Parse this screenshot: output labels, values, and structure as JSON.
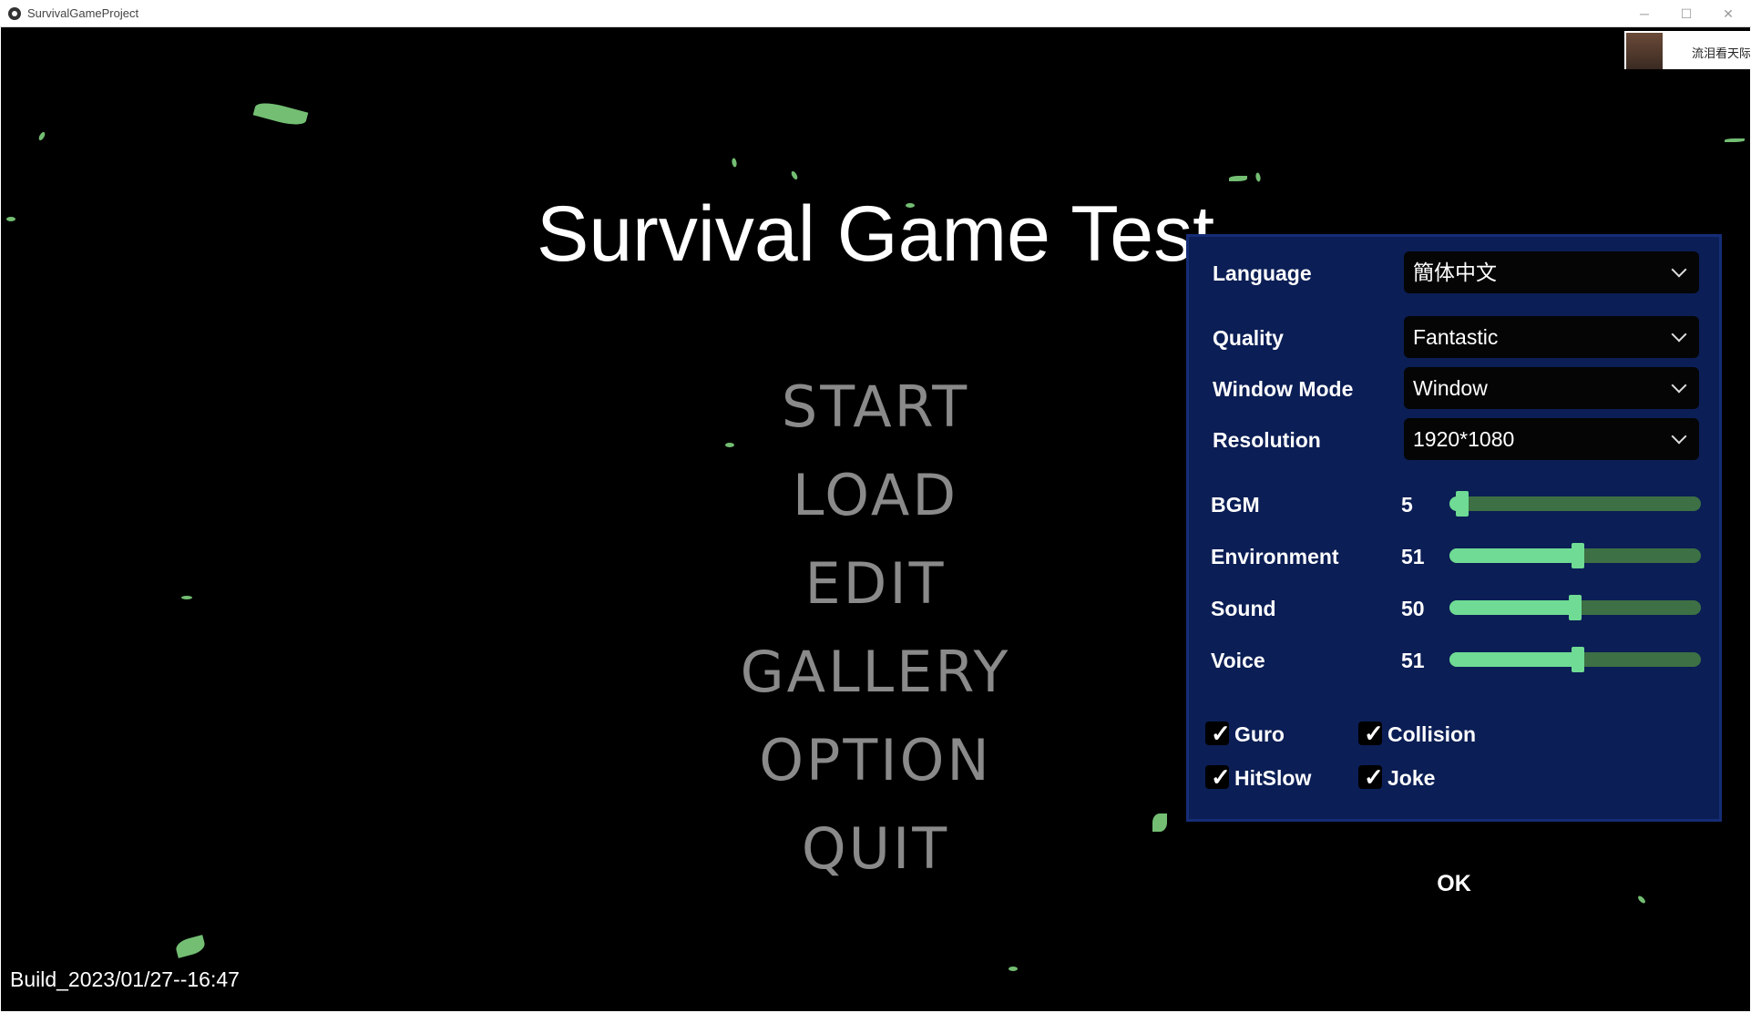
{
  "window": {
    "title": "SurvivalGameProject",
    "minimize_icon": "minimize-icon",
    "maximize_icon": "maximize-icon",
    "close_icon": "close-icon",
    "minimize_glyph": "─",
    "maximize_glyph": "☐",
    "close_glyph": "✕"
  },
  "ad": {
    "text": "流泪看天际"
  },
  "game": {
    "title": "Survival Game Test",
    "menu": [
      "START",
      "LOAD",
      "EDIT",
      "GALLERY",
      "OPTION",
      "QUIT"
    ],
    "build": "Build_2023/01/27--16:47"
  },
  "options": {
    "dropdowns": [
      {
        "label": "Language",
        "value": "簡体中文"
      },
      {
        "label": "Quality",
        "value": "Fantastic"
      },
      {
        "label": "Window Mode",
        "value": "Window"
      },
      {
        "label": "Resolution",
        "value": "1920*1080"
      }
    ],
    "sliders": [
      {
        "label": "BGM",
        "value": "5",
        "level": 5
      },
      {
        "label": "Environment",
        "value": "51",
        "level": 51
      },
      {
        "label": "Sound",
        "value": "50",
        "level": 50
      },
      {
        "label": "Voice",
        "value": "51",
        "level": 51
      }
    ],
    "checkboxes": [
      {
        "label": "Guro",
        "checked": true
      },
      {
        "label": "Collision",
        "checked": true
      },
      {
        "label": "HitSlow",
        "checked": true
      },
      {
        "label": "Joke",
        "checked": true
      }
    ],
    "check_glyph": "✓",
    "ok_label": "OK"
  },
  "colors": {
    "panel_bg": "#0b1e55",
    "slider_fill": "#6fdb94",
    "slider_track": "#3d7044",
    "menu_text": "#8a8a8a",
    "leaf": "#7fd37f"
  }
}
